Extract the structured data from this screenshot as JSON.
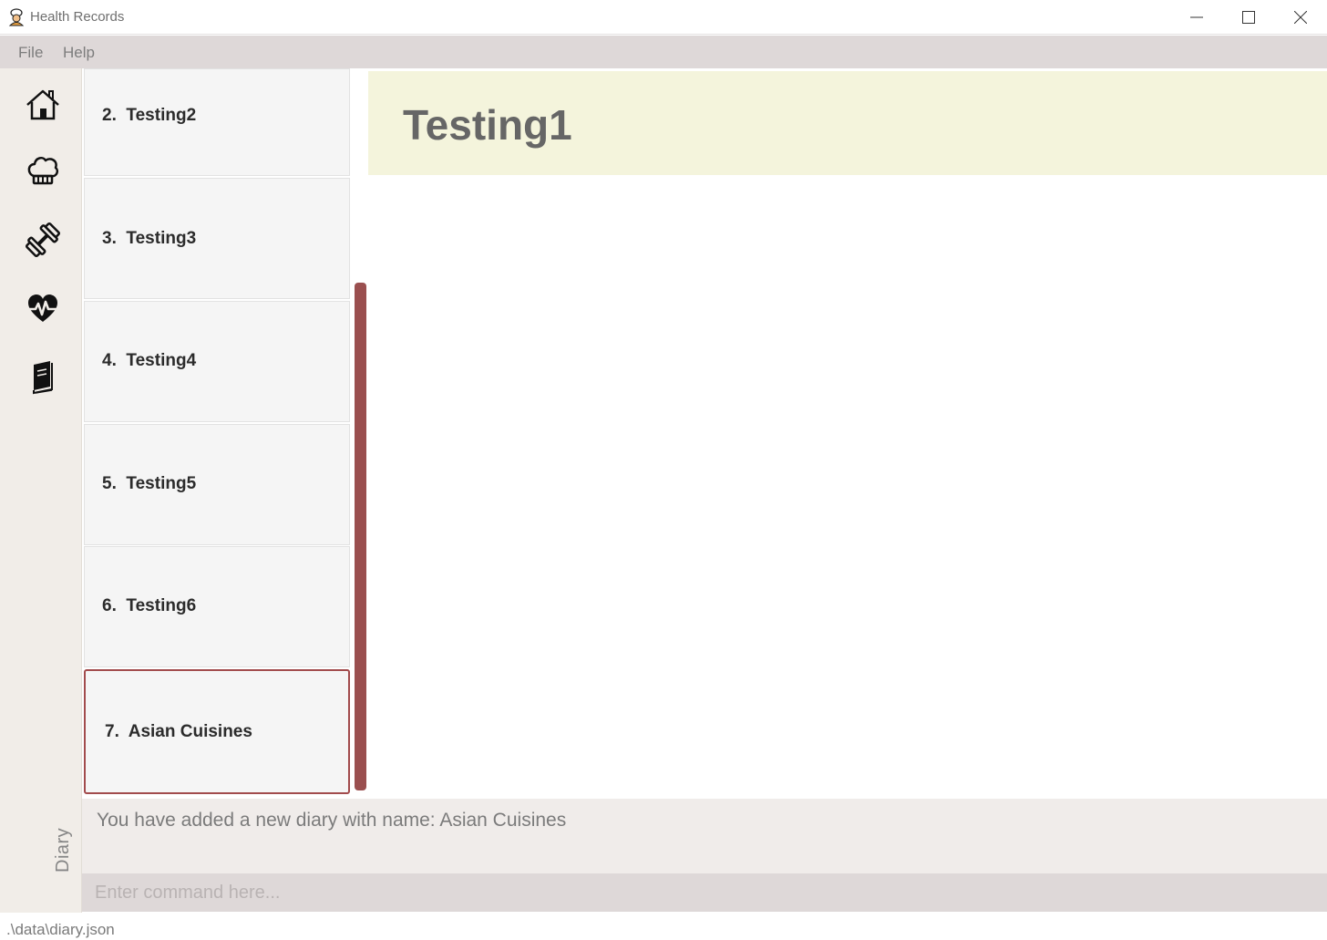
{
  "window": {
    "title": "Health Records",
    "app_icon": "chef-icon",
    "controls": [
      "minimize-icon",
      "maximize-icon",
      "close-icon"
    ]
  },
  "menu": {
    "items": [
      "File",
      "Help"
    ]
  },
  "sidebar": {
    "icons": [
      "home-icon",
      "chef-hat-icon",
      "dumbbell-icon",
      "heartbeat-icon",
      "diary-book-icon"
    ],
    "active_section": "Diary"
  },
  "list": {
    "items": [
      {
        "index": "2.",
        "name": "Testing2"
      },
      {
        "index": "3.",
        "name": "Testing3"
      },
      {
        "index": "4.",
        "name": "Testing4"
      },
      {
        "index": "5.",
        "name": "Testing5"
      },
      {
        "index": "6.",
        "name": "Testing6"
      },
      {
        "index": "7.",
        "name": "Asian Cuisines"
      }
    ],
    "selected_index": 5
  },
  "detail": {
    "title": "Testing1"
  },
  "result": {
    "message": "You have added a new diary with name: Asian Cuisines"
  },
  "command": {
    "placeholder": "Enter command here..."
  },
  "status": {
    "path": ".\\data\\diary.json"
  },
  "colors": {
    "accent": "#9a4f4f",
    "menu_bg": "#ded8d8",
    "sidebar_bg": "#f1ede8",
    "header_bg": "#f4f4dc"
  }
}
